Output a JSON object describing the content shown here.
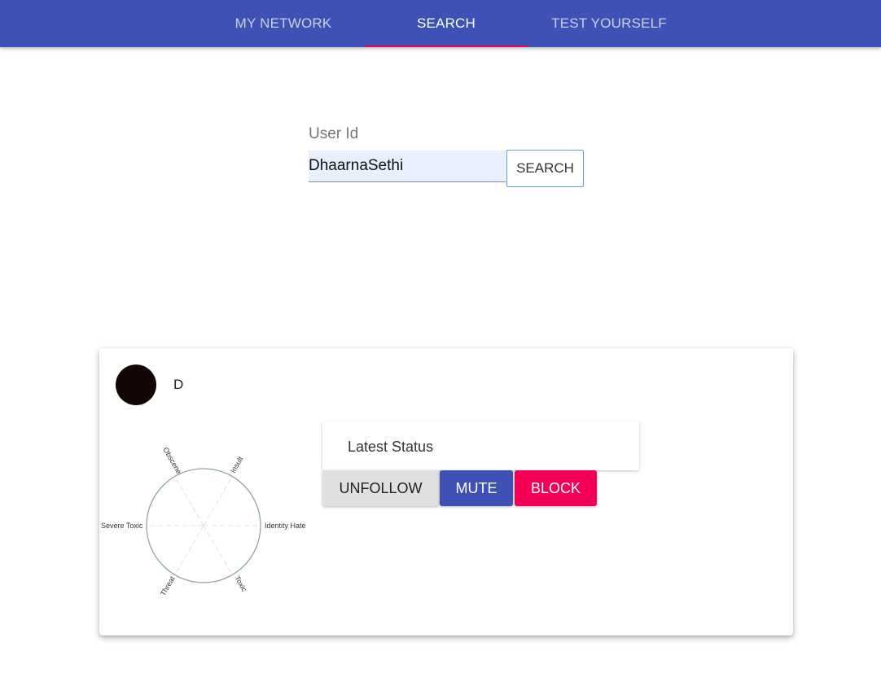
{
  "nav": {
    "tabs": [
      {
        "label": "MY NETWORK",
        "active": false
      },
      {
        "label": "SEARCH",
        "active": true
      },
      {
        "label": "TEST YOURSELF",
        "active": false
      }
    ]
  },
  "search": {
    "label": "User Id",
    "value": "DhaarnaSethi",
    "button_label": "SEARCH"
  },
  "profile": {
    "name": "D",
    "radar_axes": [
      "Obscene",
      "Insult",
      "Identity Hate",
      "Toxic",
      "Threat",
      "Severe Toxic"
    ],
    "status_title": "Latest Status",
    "actions": {
      "unfollow": "UNFOLLOW",
      "mute": "MUTE",
      "block": "BLOCK"
    }
  },
  "colors": {
    "primary": "#3f51b5",
    "accent": "#f50057",
    "avatar": "#120606"
  }
}
